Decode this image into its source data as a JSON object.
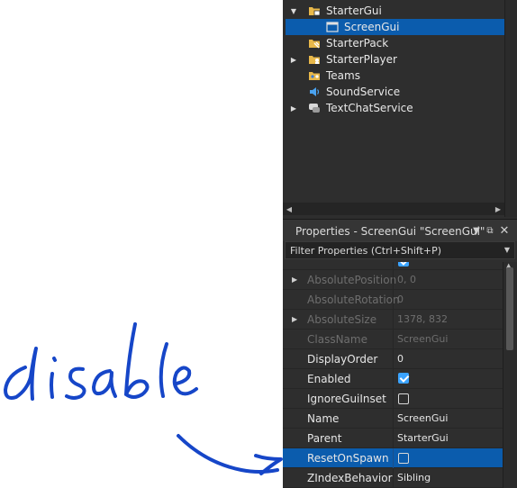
{
  "explorer": {
    "items": [
      {
        "label": "StarterGui",
        "arrow": "down",
        "icon": "startergui-folder-icon"
      },
      {
        "label": "ScreenGui",
        "arrow": "",
        "icon": "screengui-icon",
        "selected": true
      },
      {
        "label": "StarterPack",
        "arrow": "",
        "icon": "starterpack-icon"
      },
      {
        "label": "StarterPlayer",
        "arrow": "right",
        "icon": "starterplayer-icon"
      },
      {
        "label": "Teams",
        "arrow": "",
        "icon": "teams-icon"
      },
      {
        "label": "SoundService",
        "arrow": "",
        "icon": "soundservice-icon"
      },
      {
        "label": "TextChatService",
        "arrow": "right",
        "icon": "textchatservice-icon"
      }
    ]
  },
  "properties": {
    "title": "Properties - ScreenGui \"ScreenGui\"",
    "filter_placeholder": "Filter Properties (Ctrl+Shift+P)",
    "rows": [
      {
        "name": "AbsolutePosition",
        "value": "0, 0",
        "dim": true,
        "expandable": true
      },
      {
        "name": "AbsoluteRotation",
        "value": "0",
        "dim": true,
        "expandable": false
      },
      {
        "name": "AbsoluteSize",
        "value": "1378, 832",
        "dim": true,
        "expandable": true
      },
      {
        "name": "ClassName",
        "value": "ScreenGui",
        "dim": true,
        "expandable": false
      },
      {
        "name": "DisplayOrder",
        "value": "0",
        "dim": false,
        "expandable": false
      },
      {
        "name": "Enabled",
        "checkbox": true,
        "checked": true
      },
      {
        "name": "IgnoreGuiInset",
        "checkbox": true,
        "checked": false
      },
      {
        "name": "Name",
        "value": "ScreenGui",
        "dim": false,
        "expandable": false
      },
      {
        "name": "Parent",
        "value": "StarterGui",
        "dim": false,
        "expandable": false
      },
      {
        "name": "ResetOnSpawn",
        "checkbox": true,
        "checked": false,
        "selected": true
      },
      {
        "name": "ZIndexBehavior",
        "value": "Sibling",
        "dim": false,
        "expandable": false
      }
    ]
  },
  "annotation": {
    "text": "disable",
    "color": "#1646c8"
  }
}
